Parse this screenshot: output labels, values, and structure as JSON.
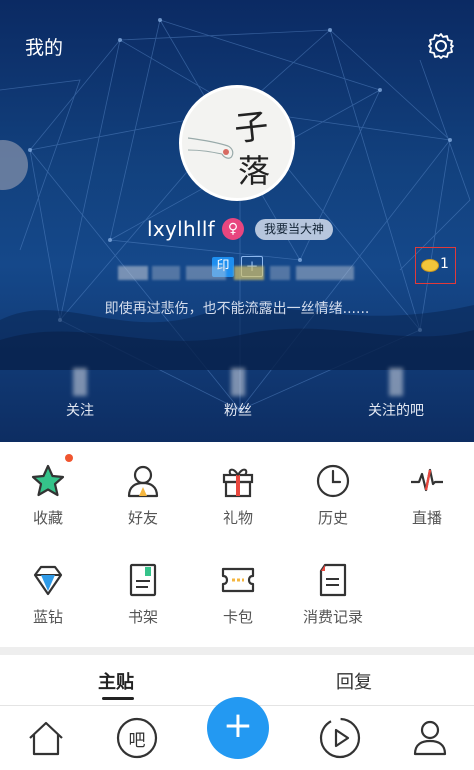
{
  "header": {
    "title": "我的"
  },
  "profile": {
    "username": "lxylhllf",
    "gender_symbol": "♀",
    "tag": "我要当大神",
    "badge_print": "印",
    "badge_plus": "+",
    "coin_count": "1",
    "motto": "即使再过悲伤，也不能流露出一丝情绪......",
    "avatar_text": [
      "子",
      "落"
    ]
  },
  "stats": [
    {
      "label": "关注"
    },
    {
      "label": "粉丝"
    },
    {
      "label": "关注的吧"
    }
  ],
  "grid": [
    {
      "label": "收藏",
      "icon": "star-icon"
    },
    {
      "label": "好友",
      "icon": "person-icon"
    },
    {
      "label": "礼物",
      "icon": "gift-icon"
    },
    {
      "label": "历史",
      "icon": "clock-icon"
    },
    {
      "label": "直播",
      "icon": "wave-icon"
    },
    {
      "label": "蓝钻",
      "icon": "diamond-icon"
    },
    {
      "label": "书架",
      "icon": "book-icon"
    },
    {
      "label": "卡包",
      "icon": "card-icon"
    },
    {
      "label": "消费记录",
      "icon": "receipt-icon"
    }
  ],
  "tabs": [
    {
      "label": "主贴"
    },
    {
      "label": "回复"
    }
  ],
  "bottom_nav": {
    "bar_label": "吧",
    "fab_label": "+"
  },
  "colors": {
    "accent": "#2399f2",
    "hero_bg": "#12417e",
    "gender": "#e8467f",
    "coin_highlight_border": "#e03a3a"
  }
}
